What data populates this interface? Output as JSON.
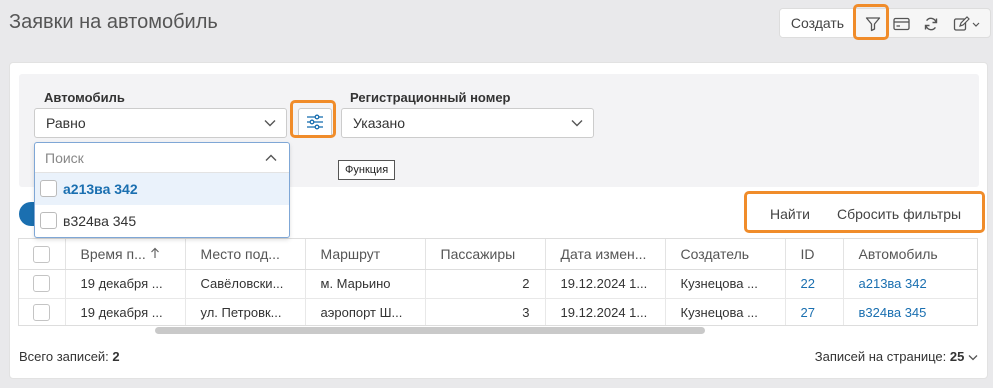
{
  "page": {
    "title": "Заявки на автомобиль"
  },
  "toolbar": {
    "create_label": "Создать",
    "icons": [
      "filter-icon",
      "card-icon",
      "refresh-icon",
      "edit-icon"
    ]
  },
  "filters": {
    "vehicle": {
      "label": "Автомобиль",
      "value": "Равно"
    },
    "function_tooltip": "Функция",
    "reg_number": {
      "label": "Регистрационный номер",
      "value": "Указано"
    },
    "dropdown": {
      "placeholder": "Поиск",
      "options": [
        "а213ва 342",
        "в324ва 345"
      ]
    }
  },
  "actions": {
    "find_label": "Найти",
    "reset_label": "Сбросить фильтры"
  },
  "table": {
    "columns": [
      "Время п...",
      "Место под...",
      "Маршрут",
      "Пассажиры",
      "Дата измен...",
      "Создатель",
      "ID",
      "Автомобиль"
    ],
    "sort_column": "Время п...",
    "rows": [
      [
        "19 декабря ...",
        "Савёловски...",
        "м. Марьино",
        "2",
        "19.12.2024 1...",
        "Кузнецова ...",
        "22",
        "а213ва 342"
      ],
      [
        "19 декабря ...",
        "ул. Петровк...",
        "аэропорт Ш...",
        "3",
        "19.12.2024 1...",
        "Кузнецова ...",
        "27",
        "в324ва 345"
      ]
    ]
  },
  "footer": {
    "total_label": "Всего записей:",
    "total_value": "2",
    "per_page_label": "Записей на странице:",
    "per_page_value": "25"
  },
  "colors": {
    "accent": "#1a6fb0",
    "highlight": "#f08c2a"
  }
}
